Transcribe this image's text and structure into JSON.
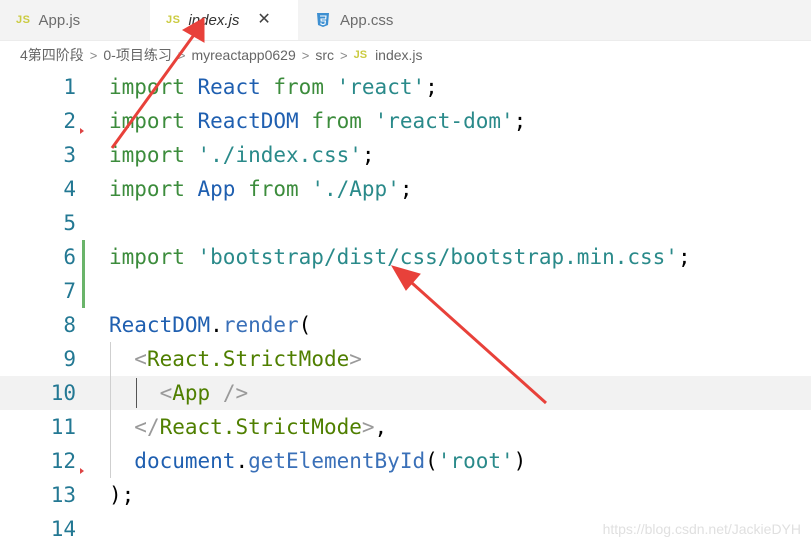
{
  "tabs": [
    {
      "icon": "JS",
      "label": "App.js"
    },
    {
      "icon": "JS",
      "label": "index.js",
      "close": "✕"
    },
    {
      "icon": "css-file-icon",
      "label": "App.css"
    }
  ],
  "breadcrumb": {
    "items": [
      "4第四阶段",
      "0-项目练习",
      "myreactapp0629",
      "src"
    ],
    "file_icon": "JS",
    "file": "index.js",
    "separator": ">"
  },
  "editor": {
    "current_line": 10,
    "lines": [
      {
        "num": "1",
        "tokens": [
          [
            "kw2",
            "import"
          ],
          [
            "plain",
            " "
          ],
          [
            "ident",
            "React"
          ],
          [
            "plain",
            " "
          ],
          [
            "kw2",
            "from"
          ],
          [
            "plain",
            " "
          ],
          [
            "str2",
            "'react'"
          ],
          [
            "plain",
            ";"
          ]
        ]
      },
      {
        "num": "2",
        "tokens": [
          [
            "kw2",
            "import"
          ],
          [
            "plain",
            " "
          ],
          [
            "ident",
            "ReactDOM"
          ],
          [
            "plain",
            " "
          ],
          [
            "kw2",
            "from"
          ],
          [
            "plain",
            " "
          ],
          [
            "str2",
            "'react-dom'"
          ],
          [
            "plain",
            ";"
          ]
        ]
      },
      {
        "num": "3",
        "tokens": [
          [
            "kw2",
            "import"
          ],
          [
            "plain",
            " "
          ],
          [
            "str2",
            "'./index.css'"
          ],
          [
            "plain",
            ";"
          ]
        ]
      },
      {
        "num": "4",
        "tokens": [
          [
            "kw2",
            "import"
          ],
          [
            "plain",
            " "
          ],
          [
            "ident",
            "App"
          ],
          [
            "plain",
            " "
          ],
          [
            "kw2",
            "from"
          ],
          [
            "plain",
            " "
          ],
          [
            "str2",
            "'./App'"
          ],
          [
            "plain",
            ";"
          ]
        ]
      },
      {
        "num": "5",
        "tokens": []
      },
      {
        "num": "6",
        "tokens": [
          [
            "kw2",
            "import"
          ],
          [
            "plain",
            " "
          ],
          [
            "str2",
            "'bootstrap/dist/css/bootstrap.min.css'"
          ],
          [
            "plain",
            ";"
          ]
        ]
      },
      {
        "num": "7",
        "tokens": []
      },
      {
        "num": "8",
        "tokens": [
          [
            "ident",
            "ReactDOM"
          ],
          [
            "plain",
            "."
          ],
          [
            "fn",
            "render"
          ],
          [
            "plain",
            "("
          ]
        ]
      },
      {
        "num": "9",
        "tokens": [
          [
            "plain",
            "  "
          ],
          [
            "tagbr",
            "<"
          ],
          [
            "tag",
            "React.StrictMode"
          ],
          [
            "tagbr",
            ">"
          ]
        ]
      },
      {
        "num": "10",
        "tokens": [
          [
            "plain",
            "    "
          ],
          [
            "tagbr",
            "<"
          ],
          [
            "tag",
            "App"
          ],
          [
            "plain",
            " "
          ],
          [
            "tagbr",
            "/>"
          ]
        ]
      },
      {
        "num": "11",
        "tokens": [
          [
            "plain",
            "  "
          ],
          [
            "tagbr",
            "</"
          ],
          [
            "tag",
            "React.StrictMode"
          ],
          [
            "tagbr",
            ">"
          ],
          [
            "plain",
            ","
          ]
        ]
      },
      {
        "num": "12",
        "tokens": [
          [
            "plain",
            "  "
          ],
          [
            "ident",
            "document"
          ],
          [
            "plain",
            "."
          ],
          [
            "fn",
            "getElementById"
          ],
          [
            "plain",
            "("
          ],
          [
            "str2",
            "'root'"
          ],
          [
            "plain",
            ")"
          ]
        ]
      },
      {
        "num": "13",
        "tokens": [
          [
            "plain",
            ");"
          ]
        ]
      },
      {
        "num": "14",
        "tokens": []
      }
    ]
  },
  "watermark": "https://blog.csdn.net/JackieDYH",
  "colors": {
    "annotation_arrow": "#e8413a",
    "modified_gutter": "#6ab46a",
    "js_icon": "#cbcb41",
    "css_icon": "#3d8fd1"
  }
}
